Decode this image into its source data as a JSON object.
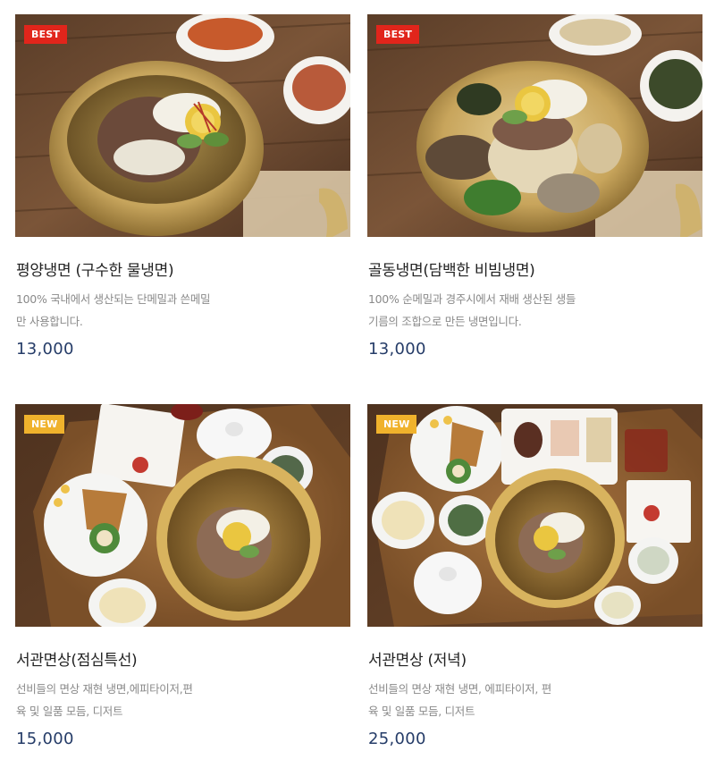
{
  "products": [
    {
      "badge": "BEST",
      "title": "평양냉면 (구수한 물냉면)",
      "desc1": "100% 국내에서 생산되는 단메밀과  쓴메밀",
      "desc2": "만 사용합니다.",
      "price": "13,000"
    },
    {
      "badge": "BEST",
      "title": "골동냉면(담백한 비빔냉면)",
      "desc1": "100% 순메밀과 경주시에서 재배 생산된 생들",
      "desc2": "기름의 조합으로 만든 냉면입니다.",
      "price": "13,000"
    },
    {
      "badge": "NEW",
      "title": "서관면상(점심특선)",
      "desc1": "선비들의 면상 재현  냉면,에피타이저,편",
      "desc2": "육 및 일품 모듬, 디저트",
      "price": "15,000"
    },
    {
      "badge": "NEW",
      "title": "서관면상 (저녁)",
      "desc1": "선비들의 면상 재현 냉면, 에피타이저, 편",
      "desc2": "육 및 일품 모듬, 디저트",
      "price": "25,000"
    }
  ],
  "colors": {
    "best_badge": "#e1251b",
    "new_badge": "#f0b22c",
    "price": "#253c68"
  }
}
